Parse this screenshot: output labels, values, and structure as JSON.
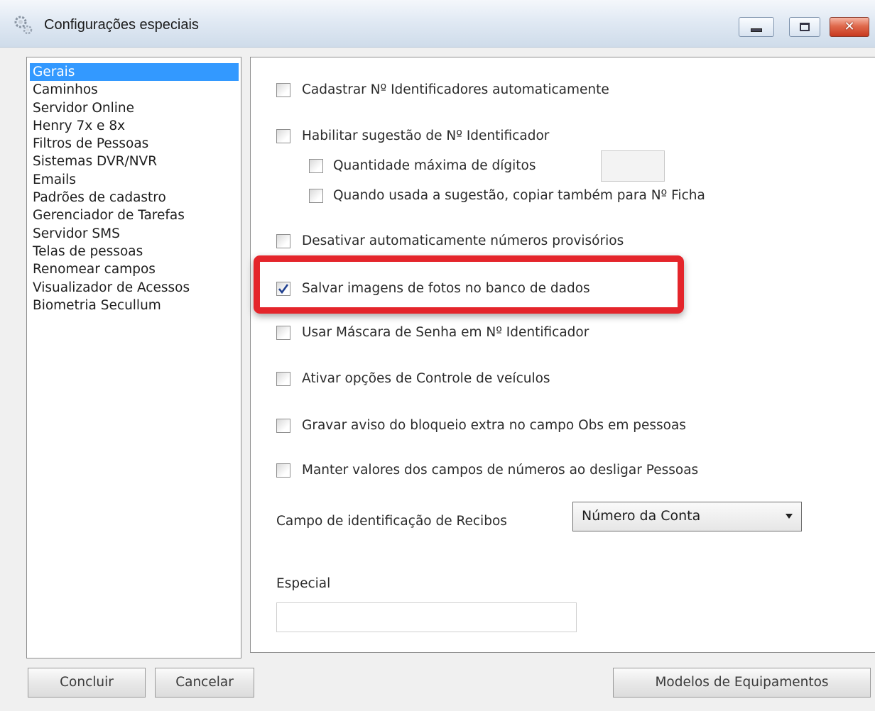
{
  "window": {
    "title": "Configurações especiais",
    "icon": "gear-icon",
    "controls": [
      "minimize-icon",
      "maximize-icon",
      "close-icon"
    ]
  },
  "sidebar": {
    "selected_index": 0,
    "items": [
      "Gerais",
      "Caminhos",
      "Servidor Online",
      "Henry 7x e 8x",
      "Filtros de Pessoas",
      "Sistemas DVR/NVR",
      "Emails",
      "Padrões de cadastro",
      "Gerenciador de Tarefas",
      "Servidor SMS",
      "Telas de pessoas",
      "Renomear campos",
      "Visualizador de Acessos",
      "Biometria Secullum"
    ]
  },
  "options": {
    "cadastrar_auto": {
      "label": "Cadastrar Nº Identificadores automaticamente",
      "checked": false
    },
    "habilitar_sugestao": {
      "label": "Habilitar sugestão de Nº Identificador",
      "checked": false
    },
    "qtd_max_digitos": {
      "label": "Quantidade máxima de dígitos",
      "checked": false,
      "value": ""
    },
    "copiar_ficha": {
      "label": "Quando usada a sugestão, copiar também para Nº Ficha",
      "checked": false
    },
    "desativar_provisorios": {
      "label": "Desativar automaticamente números provisórios",
      "checked": false
    },
    "salvar_imagens": {
      "label": "Salvar imagens de fotos no banco de dados",
      "checked": true
    },
    "mascara_senha": {
      "label": "Usar Máscara de Senha em Nº Identificador",
      "checked": false
    },
    "controle_veiculos": {
      "label": "Ativar opções de Controle de veículos",
      "checked": false
    },
    "aviso_bloqueio": {
      "label": "Gravar aviso do bloqueio extra no campo Obs em pessoas",
      "checked": false
    },
    "manter_valores": {
      "label": "Manter valores dos campos de números ao desligar Pessoas",
      "checked": false
    }
  },
  "recibos": {
    "label": "Campo de identificação de Recibos",
    "selected": "Número da Conta"
  },
  "especial": {
    "label": "Especial",
    "value": ""
  },
  "buttons": {
    "concluir": "Concluir",
    "cancelar": "Cancelar",
    "modelos": "Modelos de Equipamentos"
  },
  "colors": {
    "selection": "#3399ff",
    "highlight": "#e4252b",
    "close_button": "#c7391f"
  }
}
